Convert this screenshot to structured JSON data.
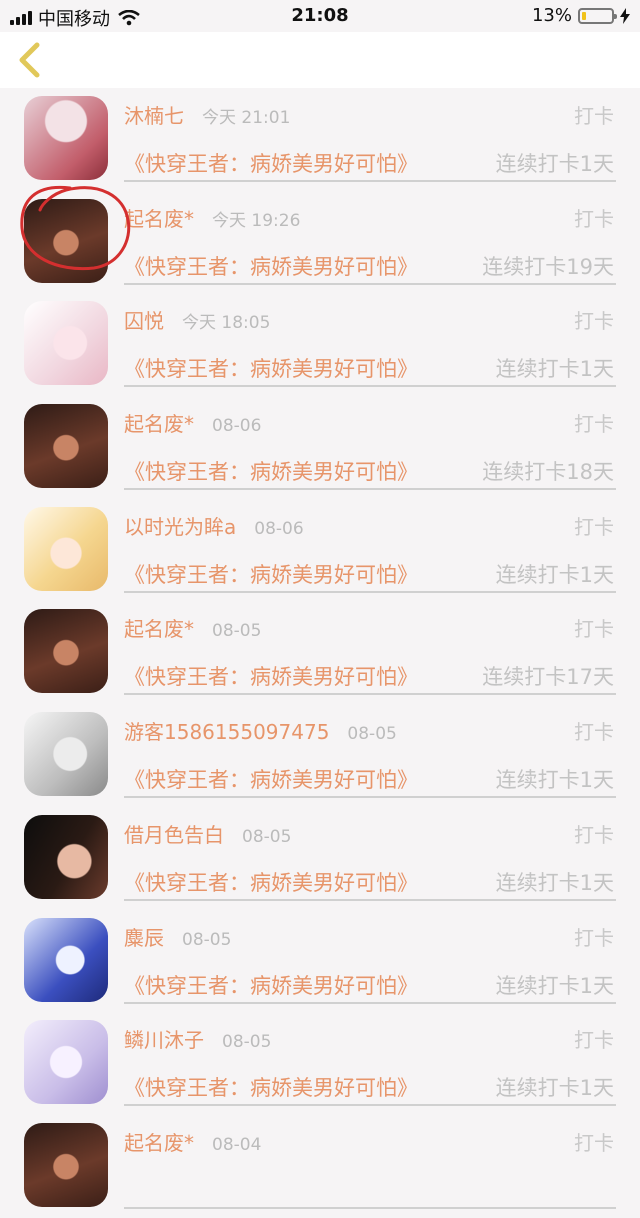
{
  "status": {
    "carrier": "中国移动",
    "time": "21:08",
    "battery": "13%"
  },
  "nav": {
    "back_icon": "chevron-left-icon"
  },
  "colors": {
    "accent": "#e7956a",
    "back": "#e1c85a",
    "annotation": "#d42f2f"
  },
  "rows": [
    {
      "name": "沐楠七",
      "time": "今天 21:01",
      "punch": "打卡",
      "book": "《快穿王者：病娇美男好可怕》",
      "streak": "连续打卡1天"
    },
    {
      "name": "起名废*",
      "time": "今天 19:26",
      "punch": "打卡",
      "book": "《快穿王者：病娇美男好可怕》",
      "streak": "连续打卡19天"
    },
    {
      "name": "囚悦",
      "time": "今天 18:05",
      "punch": "打卡",
      "book": "《快穿王者：病娇美男好可怕》",
      "streak": "连续打卡1天"
    },
    {
      "name": "起名废*",
      "time": "08-06",
      "punch": "打卡",
      "book": "《快穿王者：病娇美男好可怕》",
      "streak": "连续打卡18天"
    },
    {
      "name": "以时光为眸a",
      "time": "08-06",
      "punch": "打卡",
      "book": "《快穿王者：病娇美男好可怕》",
      "streak": "连续打卡1天"
    },
    {
      "name": "起名废*",
      "time": "08-05",
      "punch": "打卡",
      "book": "《快穿王者：病娇美男好可怕》",
      "streak": "连续打卡17天"
    },
    {
      "name": "游客1586155097475",
      "time": "08-05",
      "punch": "打卡",
      "book": "《快穿王者：病娇美男好可怕》",
      "streak": "连续打卡1天"
    },
    {
      "name": "借月色告白",
      "time": "08-05",
      "punch": "打卡",
      "book": "《快穿王者：病娇美男好可怕》",
      "streak": "连续打卡1天"
    },
    {
      "name": "麋辰",
      "time": "08-05",
      "punch": "打卡",
      "book": "《快穿王者：病娇美男好可怕》",
      "streak": "连续打卡1天"
    },
    {
      "name": "鳞川沐子",
      "time": "08-05",
      "punch": "打卡",
      "book": "《快穿王者：病娇美男好可怕》",
      "streak": "连续打卡1天"
    },
    {
      "name": "起名废*",
      "time": "08-04",
      "punch": "打卡",
      "book": "",
      "streak": ""
    }
  ]
}
